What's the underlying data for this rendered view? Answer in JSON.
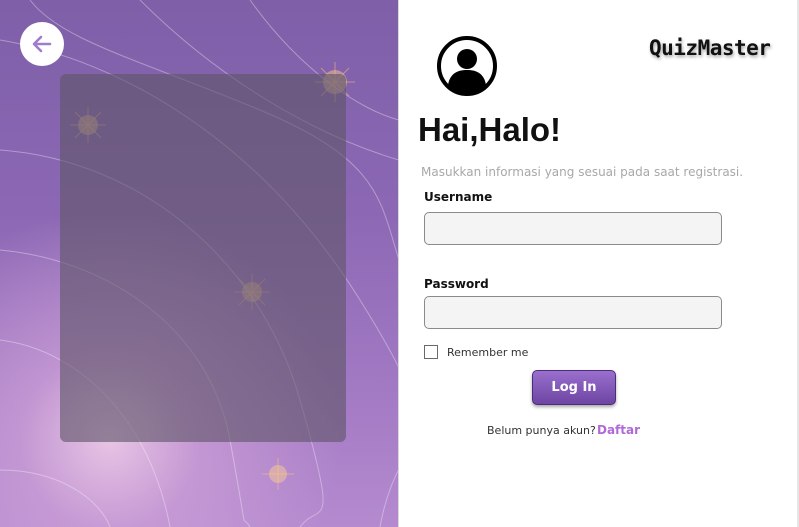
{
  "brand": {
    "name": "QuizMaster"
  },
  "login": {
    "heading": "Hai,Halo!",
    "subtitle": "Masukkan informasi yang sesuai pada saat registrasi.",
    "username_label": "Username",
    "username_value": "",
    "password_label": "Password",
    "password_value": "",
    "remember_label": "Remember me",
    "remember_checked": false,
    "login_button": "Log In",
    "signup_prompt": "Belum punya akun?",
    "signup_link": "Daftar"
  },
  "icons": {
    "back": "arrow-left-icon",
    "avatar": "user-avatar-icon"
  },
  "colors": {
    "accent": "#7c4fb0",
    "link": "#b06ad8",
    "panel": "#8c68b4"
  }
}
